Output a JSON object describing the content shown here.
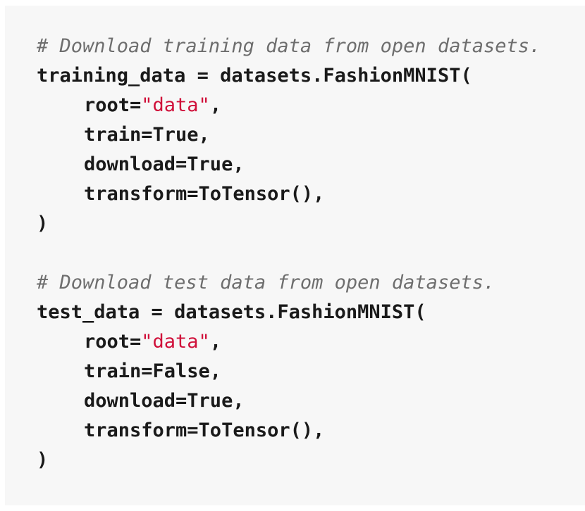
{
  "code": {
    "comment_1": "# Download training data from open datasets.",
    "line_training_open": "training_data = datasets.FashionMNIST(",
    "block_1": {
      "root_key": "root=",
      "root_value": "\"data\"",
      "root_comma": ",",
      "train": "train=True,",
      "download": "download=True,",
      "transform": "transform=ToTensor(),"
    },
    "close_1": ")",
    "comment_2": "# Download test data from open datasets.",
    "line_test_open": "test_data = datasets.FashionMNIST(",
    "block_2": {
      "root_key": "root=",
      "root_value": "\"data\"",
      "root_comma": ",",
      "train": "train=False,",
      "download": "download=True,",
      "transform": "transform=ToTensor(),"
    },
    "close_2": ")"
  }
}
